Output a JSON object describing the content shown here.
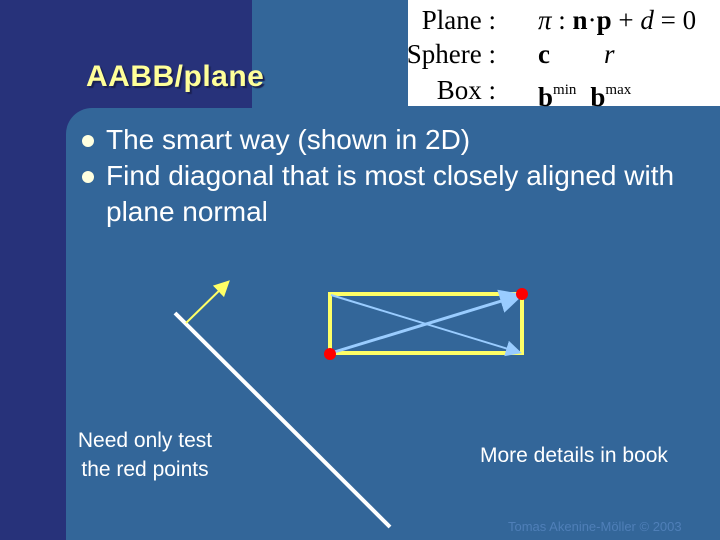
{
  "slide": {
    "title": "AABB/plane",
    "formulas": [
      {
        "label": "Plane :",
        "expr_parts": [
          "π",
          " : ",
          "n",
          "·",
          "p",
          " + ",
          "d",
          " = 0"
        ]
      },
      {
        "label": "Sphere :",
        "expr_parts": [
          "c",
          "r"
        ]
      },
      {
        "label": "Box :",
        "expr_parts": [
          "b",
          "min",
          "b",
          "max"
        ]
      }
    ],
    "bullets": [
      "The smart way (shown in 2D)",
      "Find diagonal that is most closely aligned with plane normal"
    ],
    "note_left_line1": "Need only test",
    "note_left_line2": "the red points",
    "note_right": "More details in book",
    "copyright": "Tomas Akenine-Möller © 2003"
  },
  "colors": {
    "dark_bg": "#27327a",
    "panel_bg": "#336699",
    "title": "#ffff99",
    "box_edge": "#ffff66",
    "diagonal": "#99ccff",
    "test_point": "#ff0000",
    "plane_line": "#ffffff"
  }
}
